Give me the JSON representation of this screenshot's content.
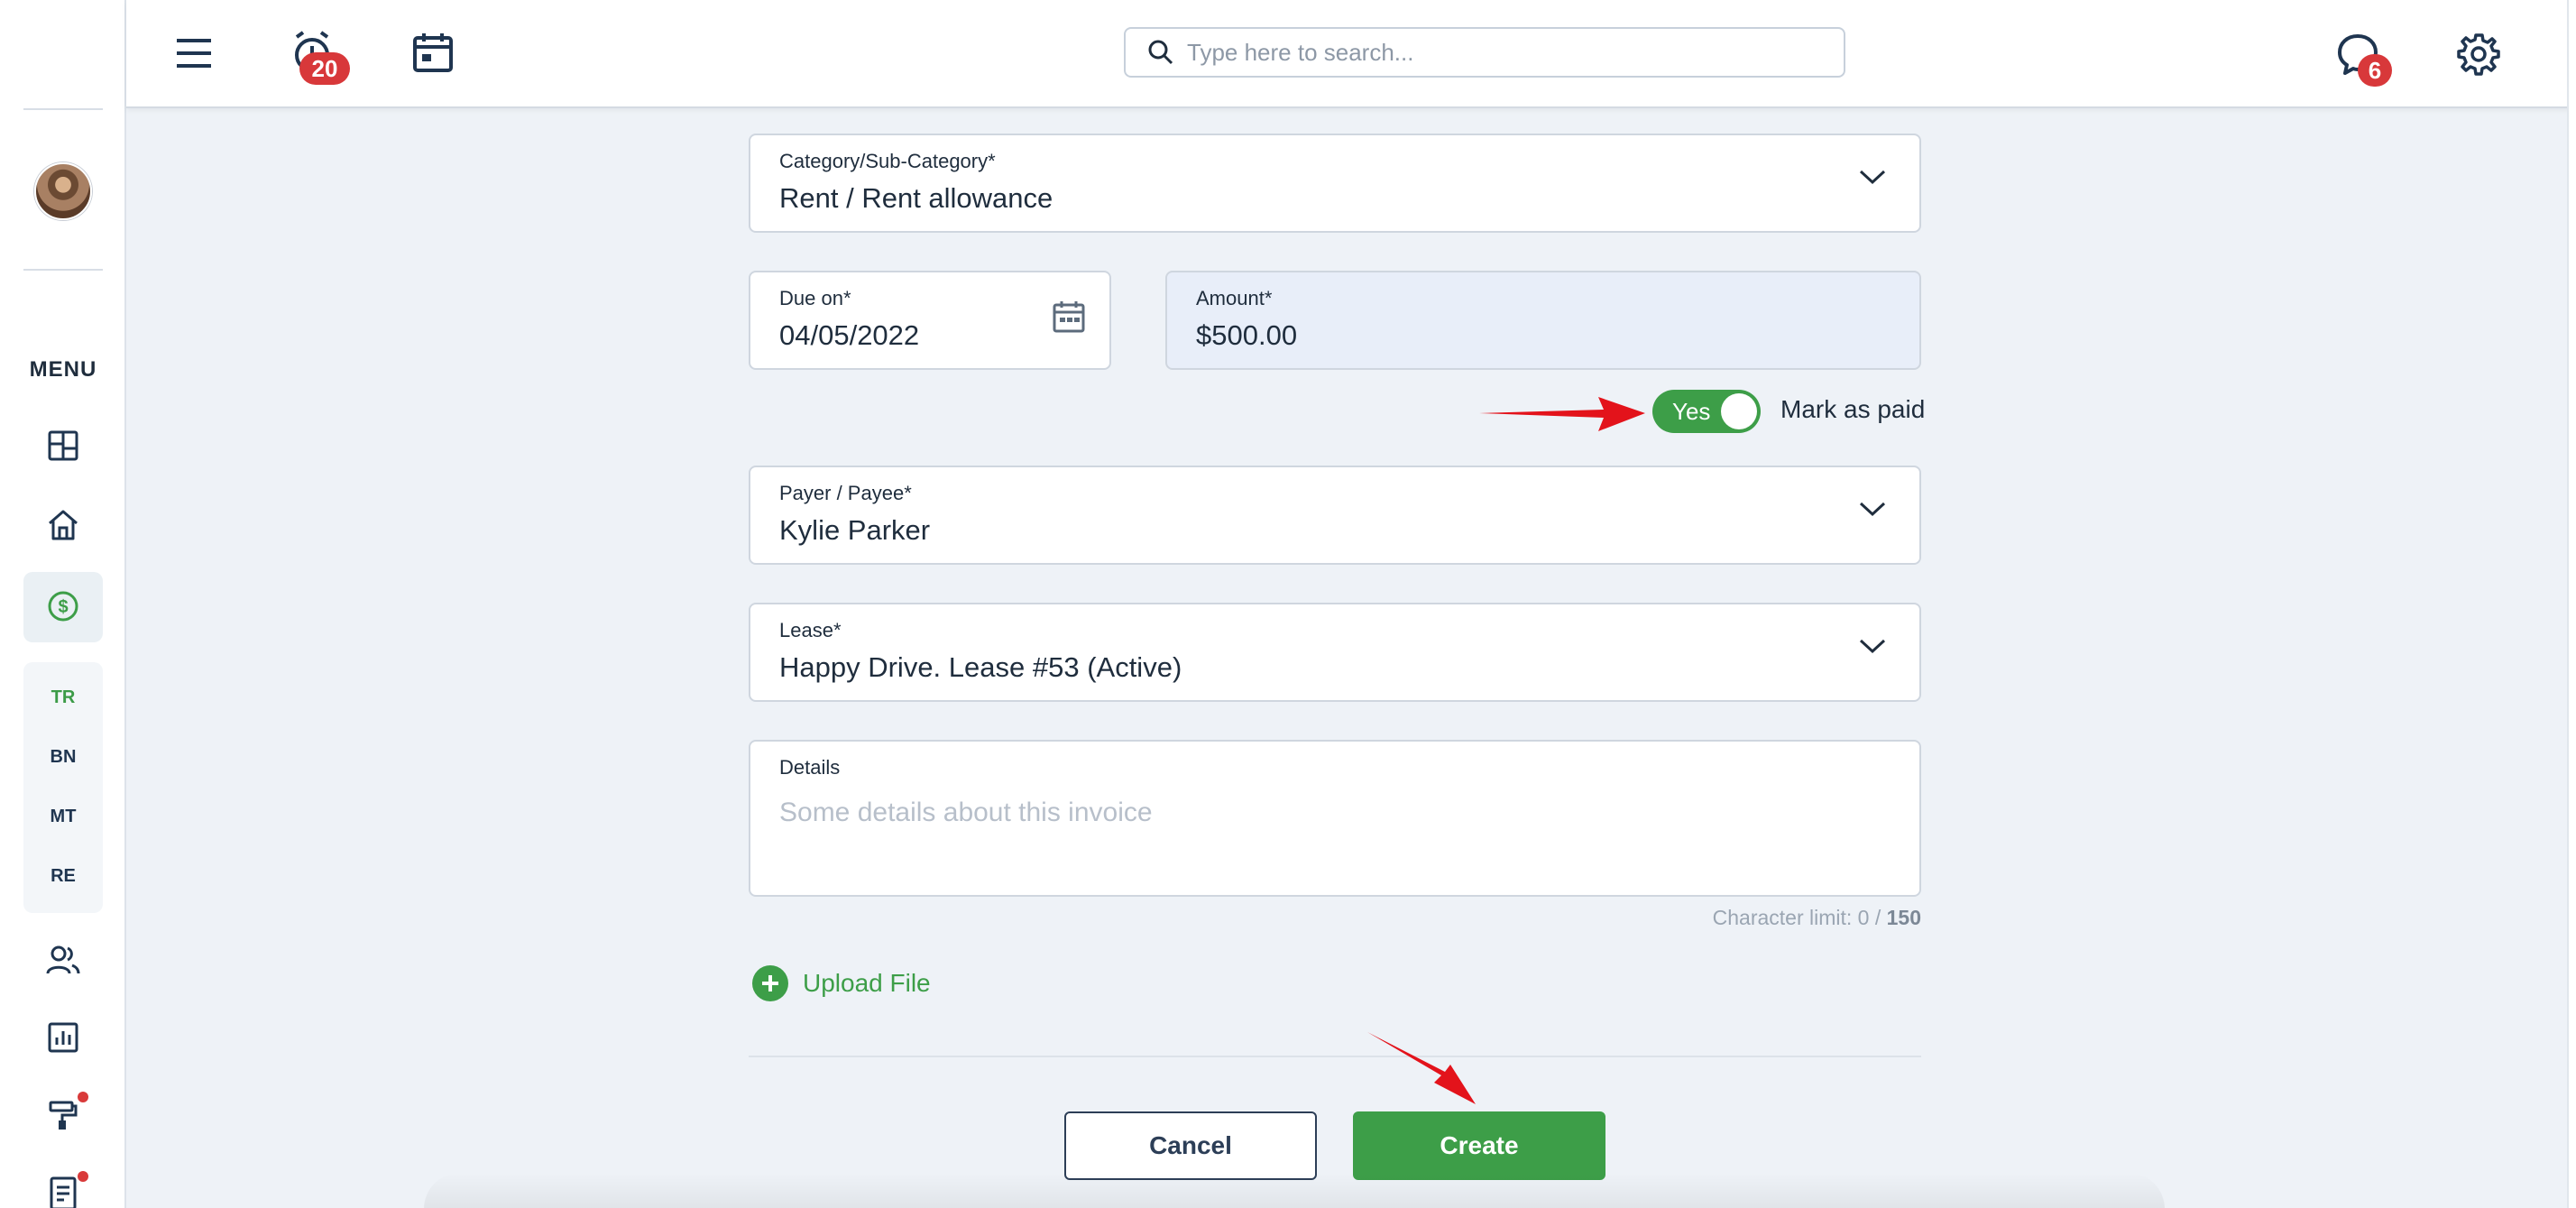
{
  "header": {
    "alerts_badge": "20",
    "messages_badge": "6",
    "search_placeholder": "Type here to search..."
  },
  "sidebar": {
    "menu_label": "MENU",
    "sub_items": [
      "TR",
      "BN",
      "MT",
      "RE"
    ]
  },
  "form": {
    "category": {
      "label": "Category/Sub-Category*",
      "value": "Rent / Rent allowance"
    },
    "due_on": {
      "label": "Due on*",
      "value": "04/05/2022"
    },
    "amount": {
      "label": "Amount*",
      "value": "$500.00"
    },
    "mark_paid": {
      "toggle_text": "Yes",
      "label": "Mark as paid",
      "on": true
    },
    "payer": {
      "label": "Payer / Payee*",
      "value": "Kylie Parker"
    },
    "lease": {
      "label": "Lease*",
      "value": "Happy Drive. Lease #53 (Active)"
    },
    "details": {
      "label": "Details",
      "placeholder": "Some details about this invoice"
    },
    "char_limit": {
      "prefix": "Character limit: 0 / ",
      "max": "150"
    },
    "upload_label": "Upload File"
  },
  "actions": {
    "cancel": "Cancel",
    "create": "Create"
  },
  "colors": {
    "accent_green": "#3d9e48",
    "badge_red": "#d8383a",
    "annotation_red": "#e3131b"
  }
}
